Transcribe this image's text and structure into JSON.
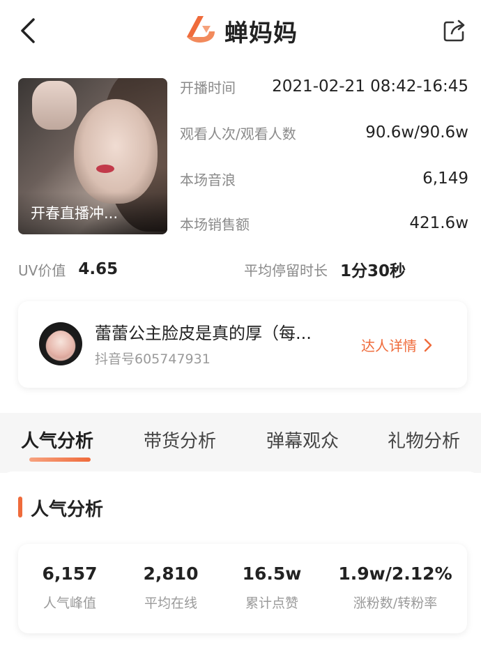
{
  "header": {
    "title": "蝉妈妈",
    "back_icon": "chevron-left-icon",
    "share_icon": "share-icon",
    "logo_icon": "chanmama-logo-icon",
    "accent_color": "#ef6b3b"
  },
  "live": {
    "cover_title": "开春直播冲...",
    "info": [
      {
        "label": "开播时间",
        "value": "2021-02-21 08:42-16:45"
      },
      {
        "label": "观看人次/观看人数",
        "value": "90.6w/90.6w"
      },
      {
        "label": "本场音浪",
        "value": "6,149"
      },
      {
        "label": "本场销售额",
        "value": "421.6w"
      }
    ],
    "uv_label": "UV价值",
    "uv_value": "4.65",
    "stay_label": "平均停留时长",
    "stay_value": "1分30秒"
  },
  "influencer": {
    "name": "蕾蕾公主脸皮是真的厚（每...",
    "douyin_id": "抖音号605747931",
    "detail_link": "达人详情"
  },
  "tabs": [
    {
      "label": "人气分析",
      "active": true
    },
    {
      "label": "带货分析",
      "active": false
    },
    {
      "label": "弹幕观众",
      "active": false
    },
    {
      "label": "礼物分析",
      "active": false
    }
  ],
  "analysis": {
    "section_title": "人气分析",
    "stats": [
      {
        "value": "6,157",
        "label": "人气峰值"
      },
      {
        "value": "2,810",
        "label": "平均在线"
      },
      {
        "value": "16.5w",
        "label": "累计点赞"
      },
      {
        "value": "1.9w/2.12%",
        "label": "涨粉数/转粉率"
      }
    ]
  }
}
